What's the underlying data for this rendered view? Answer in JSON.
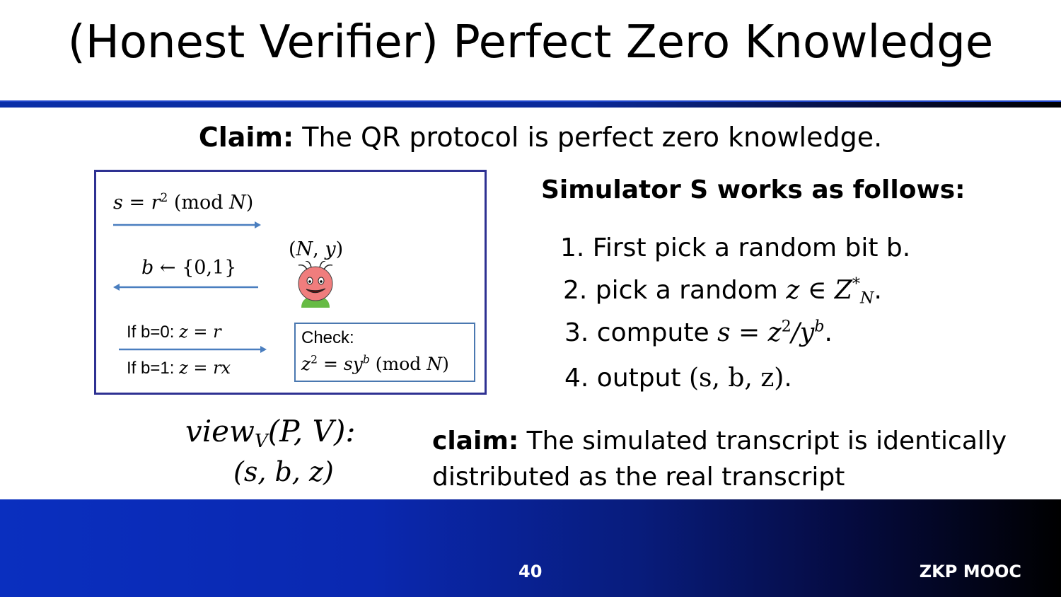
{
  "slide": {
    "title": "(Honest Verifier) Perfect Zero Knowledge",
    "claim_top": {
      "label": "Claim:",
      "text": " The QR protocol is perfect zero knowledge."
    },
    "protocol": {
      "msg1": {
        "lhs": "s",
        "eq": " = ",
        "r": "r",
        "exp": "2",
        "mod_open": " (mod ",
        "N": "N",
        "mod_close": ")"
      },
      "msg2": {
        "b": "b",
        "arrow": " ← ",
        "set": "{0,1}"
      },
      "verifier": {
        "open": "(",
        "N": "N",
        "comma": ", ",
        "y": "y",
        "close": ")"
      },
      "msg3a": {
        "label": "If b=0: ",
        "expr": "z = r"
      },
      "msg3b": {
        "label": "If b=1: ",
        "expr": "z = rx"
      },
      "check": {
        "label": "Check:",
        "z": "z",
        "z_exp": "2",
        "eq": " = ",
        "sy": "sy",
        "b_exp": "b",
        "mod": " (mod ",
        "N": "N",
        "close": ")"
      }
    },
    "simulator": {
      "title": "Simulator S works as follows:",
      "step1": "1. First pick a random bit b.",
      "step2_text": "2. pick a random ",
      "step2_math": "z ∈ Z",
      "step2_sup": "*",
      "step2_sub": "N",
      "step2_end": ".",
      "step3_text": "3. compute ",
      "step3_math_a": "s = z",
      "step3_sup1": "2",
      "step3_math_b": "/y",
      "step3_sup2": "b",
      "step3_end": ".",
      "step4_text": "4. output ",
      "step4_math": "(s, b, z)",
      "step4_end": "."
    },
    "view": {
      "name": "view",
      "sub": "V",
      "args": "(P, V):",
      "value": "(s, b, z)"
    },
    "claim_bottom": {
      "label": "claim:",
      "text": " The simulated transcript is identically distributed as the real transcript"
    },
    "footer": {
      "page": "40",
      "brand": "ZKP MOOC"
    }
  },
  "colors": {
    "arrow": "#4a7ebf",
    "protocol_border": "#2e3192",
    "check_border": "#4a78b0",
    "face": "#f07d7d",
    "body": "#66bb44"
  },
  "icons": [
    "verifier-face-icon",
    "arrow-right-icon",
    "arrow-left-icon"
  ]
}
